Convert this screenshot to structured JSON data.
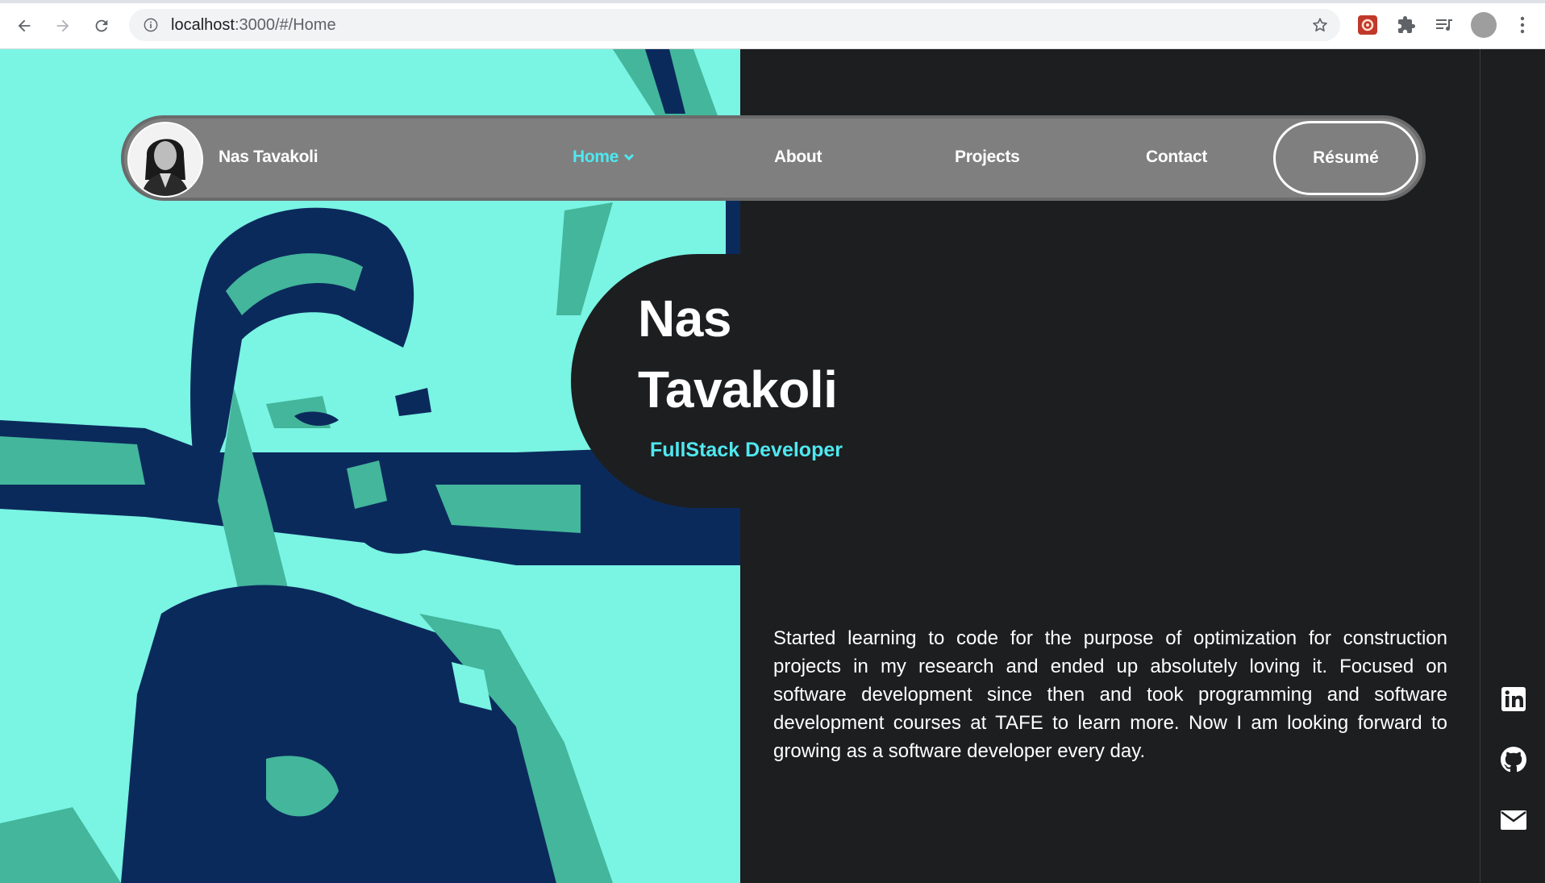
{
  "browser": {
    "url_host": "localhost",
    "url_rest": ":3000/#/Home"
  },
  "nav": {
    "brand_name": "Nas Tavakoli",
    "links": [
      {
        "label": "Home"
      },
      {
        "label": "About"
      },
      {
        "label": "Projects"
      },
      {
        "label": "Contact"
      }
    ],
    "resume_label": "Résumé"
  },
  "hero": {
    "first_name": "Nas",
    "last_name": "Tavakoli",
    "role": "FullStack Developer",
    "description": "Started learning to code for the purpose of optimization for construction projects in my research and ended up absolutely loving it. Focused on software development since then and took programming and software development courses at TAFE to learn more. Now I am looking forward to growing as a software developer every day."
  },
  "social": [
    "linkedin-icon",
    "github-icon",
    "email-icon"
  ],
  "colors": {
    "background": "#1d1e20",
    "accent": "#4fe8f0",
    "hero_light": "#7af4e3",
    "hero_dark": "#0b2a5c",
    "navbar": "#7f7f7f"
  }
}
